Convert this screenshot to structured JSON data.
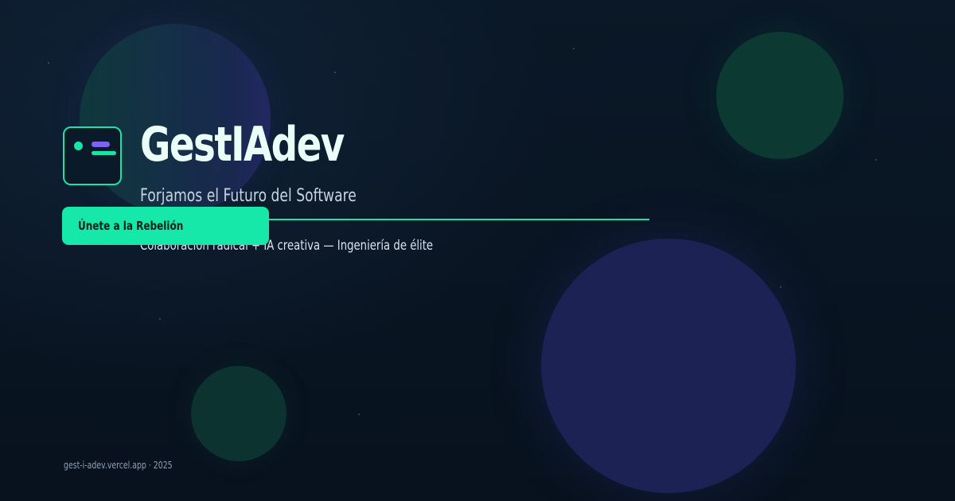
{
  "brand": {
    "name": "GestIAdev",
    "tagline": "Forjamos el Futuro del Software",
    "subtitle": "Colaboración radical + IA creativa — Ingeniería de élite"
  },
  "cta": {
    "label": "Únete a la Rebelión"
  },
  "footer": {
    "text": "gest-i-adev.vercel.app · 2025"
  },
  "logo": {
    "icon": "terminal-card-icon"
  },
  "colors": {
    "background": "#091422",
    "accent": "#16e8a9",
    "accent_secondary": "#7c63f2",
    "title": "#eafff8",
    "text": "#c7d4df",
    "muted": "#8aa0b3"
  }
}
